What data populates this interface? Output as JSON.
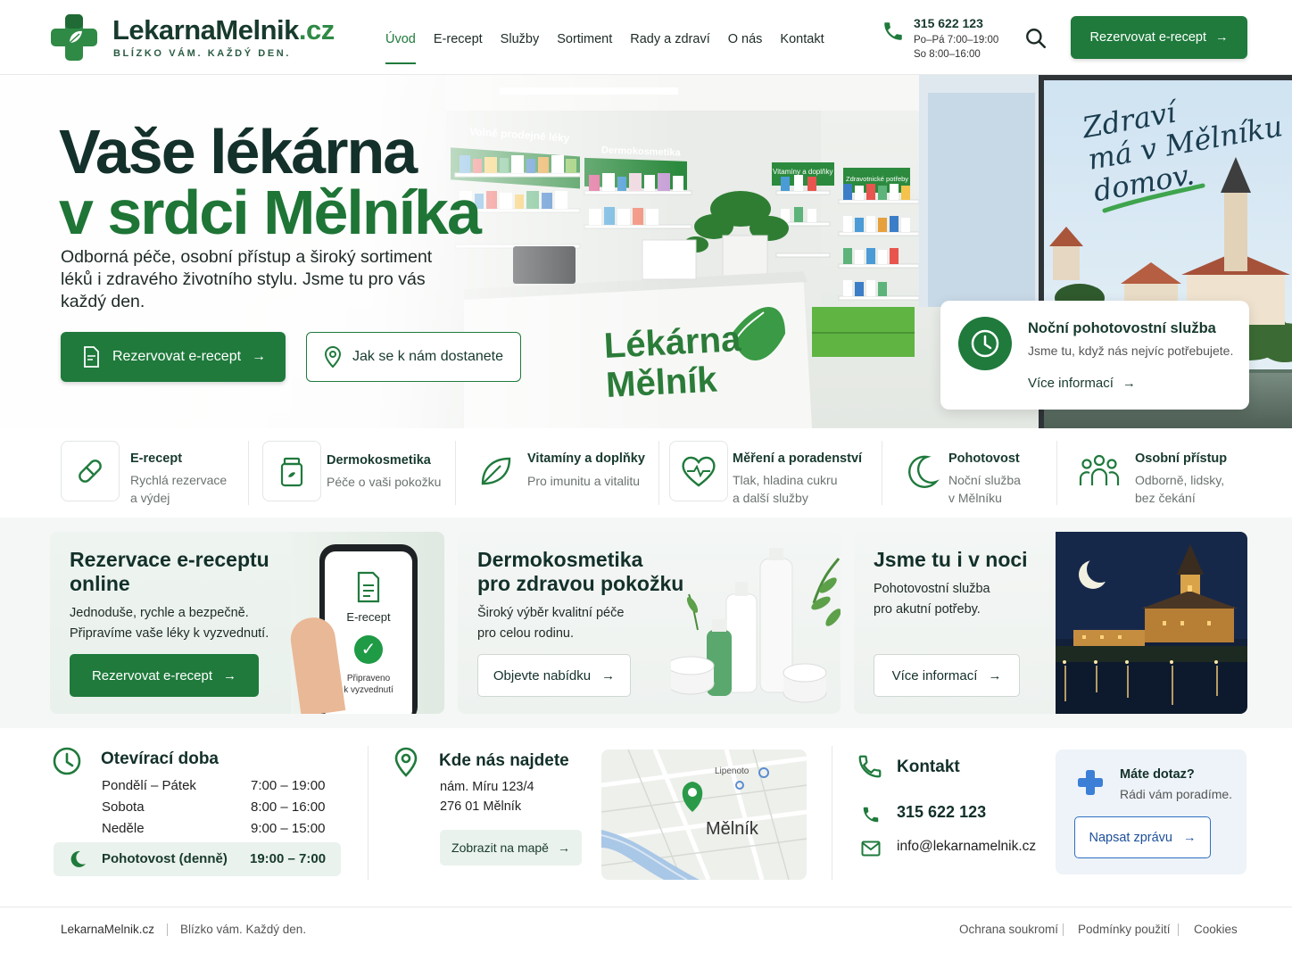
{
  "header": {
    "logo_name": "LekarnaMelnik",
    "logo_tld": ".cz",
    "tagline": "BLÍZKO VÁM. KAŽDÝ DEN.",
    "nav": [
      "Úvod",
      "E-recept",
      "Služby",
      "Sortiment",
      "Rady a zdraví",
      "O nás",
      "Kontakt"
    ],
    "phone": "315 622 123",
    "hours_weekday": "Po–Pá 7:00–19:00",
    "hours_saturday": "So 8:00–16:00",
    "cta": "Rezervovat e-recept"
  },
  "hero": {
    "title_line1": "Vaše lékárna",
    "title_line2": "v srdci Mělníka",
    "subtitle": "Odborná péče, osobní přístup a široký sortiment léků i zdravého životního stylu. Jsme tu pro vás každý den.",
    "btn_primary": "Rezervovat e-recept",
    "btn_secondary": "Jak se k nám dostanete",
    "shelf_sign1": "Volně prodejné léky",
    "shelf_sign2": "Dermokosmetika",
    "shelf_sign3": "Vitamíny a doplňky",
    "shelf_sign4": "Zdravotnické potřeby",
    "counter_text1": "Lékárna",
    "counter_text2": "Mělník",
    "handwritten": "Zdraví\nmá v Mělníku\ndomov.",
    "night_card": {
      "title": "Noční pohotovostní služba",
      "subtitle": "Jsme tu, když nás nejvíc potřebujete.",
      "link": "Více informací"
    }
  },
  "features": [
    {
      "title": "E-recept",
      "subtitle": "Rychlá rezervace\na výdej",
      "icon": "pill-icon"
    },
    {
      "title": "Dermokosmetika",
      "subtitle": "Péče o vaši pokožku",
      "icon": "cosmetic-jar-icon"
    },
    {
      "title": "Vitamíny a doplňky",
      "subtitle": "Pro imunitu a vitalitu",
      "icon": "leaf-icon"
    },
    {
      "title": "Měření a poradenství",
      "subtitle": "Tlak, hladina cukru\na další služby",
      "icon": "heart-pulse-icon"
    },
    {
      "title": "Pohotovost",
      "subtitle": "Noční služba\nv Mělníku",
      "icon": "moon-icon"
    },
    {
      "title": "Osobní přístup",
      "subtitle": "Odborně, lidsky,\nbez čekání",
      "icon": "people-icon"
    }
  ],
  "promo": {
    "erecept": {
      "title": "Rezervace e-receptu\nonline",
      "desc": "Jednoduše, rychle a bezpečně.\nPřipravíme vaše léky k vyzvednutí.",
      "button": "Rezervovat e-recept",
      "phone_label": "E-recept",
      "phone_status": "Připraveno\nk vyzvednutí"
    },
    "derm": {
      "title": "Dermokosmetika\npro zdravou pokožku",
      "desc": "Široký výběr kvalitní péče\npro celou rodinu.",
      "button": "Objevte nabídku"
    },
    "night": {
      "title": "Jsme tu i v noci",
      "desc": "Pohotovostní služba\npro akutní potřeby.",
      "button": "Více informací"
    }
  },
  "info": {
    "hours_title": "Otevírací doba",
    "hours": [
      {
        "day": "Pondělí – Pátek",
        "time": "7:00 – 19:00"
      },
      {
        "day": "Sobota",
        "time": "8:00 – 16:00"
      },
      {
        "day": "Neděle",
        "time": "9:00 – 15:00"
      }
    ],
    "pohotovost_day": "Pohotovost (denně)",
    "pohotovost_time": "19:00 – 7:00",
    "location_title": "Kde nás najdete",
    "address1": "nám. Míru 123/4",
    "address2": "276 01 Mělník",
    "map_button": "Zobrazit na mapě",
    "map_city": "Mělník",
    "map_small": "Lipenoto",
    "contact_title": "Kontakt",
    "contact_phone": "315 622 123",
    "contact_email": "info@lekarnamelnik.cz",
    "question_title": "Máte dotaz?",
    "question_sub": "Rádi vám poradíme.",
    "question_button": "Napsat zprávu"
  },
  "footer": {
    "site": "LekarnaMelnik.cz",
    "slogan": "Blízko vám. Každý den.",
    "privacy": "Ochrana soukromí",
    "terms": "Podmínky použití",
    "cookies": "Cookies"
  },
  "colors": {
    "primary": "#1f7a3c",
    "dark": "#13302a",
    "light_bg": "#eef4f0"
  }
}
